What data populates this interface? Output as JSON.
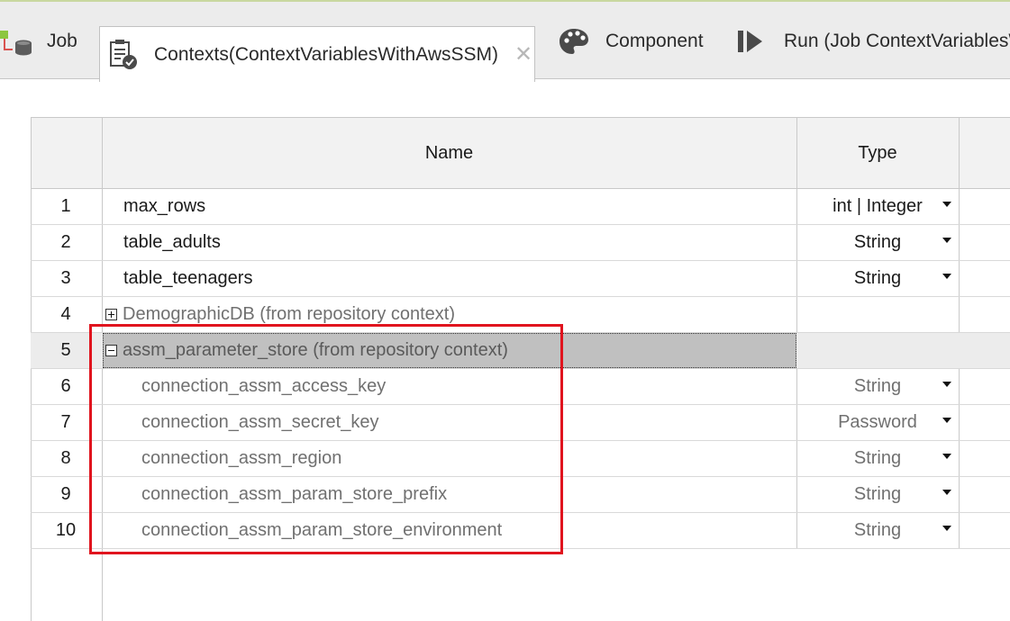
{
  "tabs": [
    {
      "label": "Job",
      "icon": "job-icon"
    },
    {
      "label": "Contexts(ContextVariablesWithAwsSSM)",
      "icon": "contexts-icon",
      "active": true
    },
    {
      "label": "Component",
      "icon": "palette-icon"
    },
    {
      "label": "Run (Job ContextVariablesW",
      "icon": "run-icon"
    }
  ],
  "table": {
    "headers": {
      "name": "Name",
      "type": "Type"
    },
    "rows": [
      {
        "num": "1",
        "name": "max_rows",
        "type": "int | Integer"
      },
      {
        "num": "2",
        "name": "table_adults",
        "type": "String"
      },
      {
        "num": "3",
        "name": "table_teenagers",
        "type": "String"
      },
      {
        "num": "4",
        "name": "DemographicDB (from repository context)",
        "type": "",
        "group": "collapsed"
      },
      {
        "num": "5",
        "name": "assm_parameter_store (from repository context)",
        "type": "",
        "group": "expanded",
        "selected": true
      },
      {
        "num": "6",
        "name": "connection_assm_access_key",
        "type": "String"
      },
      {
        "num": "7",
        "name": "connection_assm_secret_key",
        "type": "Password"
      },
      {
        "num": "8",
        "name": "connection_assm_region",
        "type": "String"
      },
      {
        "num": "9",
        "name": "connection_assm_param_store_prefix",
        "type": "String"
      },
      {
        "num": "10",
        "name": "connection_assm_param_store_environment",
        "type": "String"
      }
    ]
  },
  "colors": {
    "highlight_box": "#e0141e",
    "selected_row": "#c0c0c0",
    "job_icon_green": "#8cc63f",
    "job_icon_red": "#d9534f"
  }
}
